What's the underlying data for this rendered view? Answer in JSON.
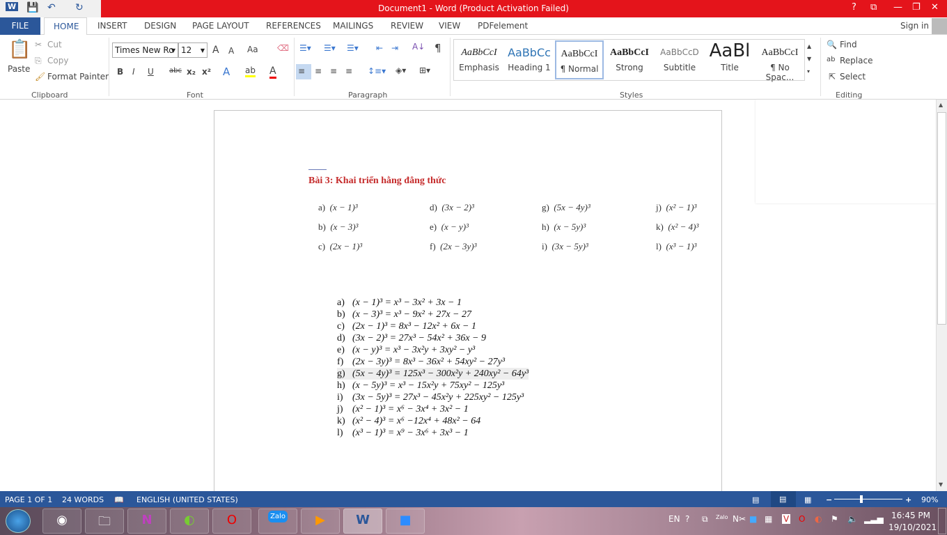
{
  "window": {
    "title": "Document1 - Word (Product Activation Failed)",
    "help": "?",
    "controls": [
      "ribbon-display",
      "minimize",
      "restore",
      "close"
    ]
  },
  "ribbon_tabs": [
    "FILE",
    "HOME",
    "INSERT",
    "DESIGN",
    "PAGE LAYOUT",
    "REFERENCES",
    "MAILINGS",
    "REVIEW",
    "VIEW",
    "PDFelement"
  ],
  "sign_in": "Sign in",
  "clipboard": {
    "paste": "Paste",
    "cut": "Cut",
    "copy": "Copy",
    "format_painter": "Format Painter",
    "group": "Clipboard"
  },
  "font": {
    "name": "Times New Ro",
    "size": "12",
    "group": "Font",
    "bold": "B",
    "italic": "I",
    "underline": "U",
    "strike": "abc",
    "sub": "x₂",
    "sup": "x²",
    "case": "Aa",
    "grow": "A",
    "shrink": "A"
  },
  "paragraph": {
    "group": "Paragraph",
    "pilcrow": "¶"
  },
  "styles": {
    "group": "Styles",
    "items": [
      {
        "preview": "AaBbCcI",
        "label": "Emphasis"
      },
      {
        "preview": "AaBbCc",
        "label": "Heading 1"
      },
      {
        "preview": "AaBbCcI",
        "label": "¶ Normal"
      },
      {
        "preview": "AaBbCcI",
        "label": "Strong"
      },
      {
        "preview": "AaBbCcD",
        "label": "Subtitle"
      },
      {
        "preview": "AaBl",
        "label": "Title"
      },
      {
        "preview": "AaBbCcI",
        "label": "¶ No Spac..."
      }
    ]
  },
  "editing": {
    "find": "Find",
    "replace": "Replace",
    "select": "Select",
    "group": "Editing"
  },
  "document": {
    "heading": "Bài 3: Khai triển hằng đẳng thức",
    "exercises": [
      [
        "a)",
        "(x − 1)³"
      ],
      [
        "b)",
        "(x − 3)³"
      ],
      [
        "c)",
        "(2x − 1)³"
      ],
      [
        "d)",
        "(3x − 2)³"
      ],
      [
        "e)",
        "(x − y)³"
      ],
      [
        "f)",
        "(2x − 3y)³"
      ],
      [
        "g)",
        "(5x − 4y)³"
      ],
      [
        "h)",
        "(x − 5y)³"
      ],
      [
        "i)",
        "(3x − 5y)³"
      ],
      [
        "j)",
        "(x² − 1)³"
      ],
      [
        "k)",
        "(x² − 4)³"
      ],
      [
        "l)",
        "(x³ − 1)³"
      ]
    ],
    "answers": [
      [
        "a)",
        "(x − 1)³ = x³ − 3x² + 3x − 1"
      ],
      [
        "b)",
        "(x − 3)³ = x³ − 9x² + 27x − 27"
      ],
      [
        "c)",
        "(2x − 1)³ = 8x³ − 12x² + 6x − 1"
      ],
      [
        "d)",
        "(3x − 2)³ = 27x³ − 54x² + 36x − 9"
      ],
      [
        "e)",
        "(x − y)³ = x³ − 3x²y + 3xy² − y³"
      ],
      [
        "f)",
        "(2x − 3y)³ = 8x³ − 36x² + 54xy² − 27y³"
      ],
      [
        "g)",
        "(5x − 4y)³ = 125x³ − 300x²y + 240xy² − 64y³"
      ],
      [
        "h)",
        "(x − 5y)³ = x³ − 15x²y + 75xy² − 125y³"
      ],
      [
        "i)",
        "(3x − 5y)³ = 27x³ − 45x²y + 225xy² − 125y³"
      ],
      [
        "j)",
        "(x² − 1)³ = x⁶ − 3x⁴ + 3x² − 1"
      ],
      [
        "k)",
        "(x² − 4)³ = x⁶ −12x⁴ + 48x² − 64"
      ],
      [
        "l)",
        "(x³ − 1)³ = x⁹ − 3x⁶ + 3x³ − 1"
      ]
    ]
  },
  "status": {
    "page": "PAGE 1 OF 1",
    "words": "24 WORDS",
    "language": "ENGLISH (UNITED STATES)",
    "zoom": "90%",
    "zoom_percent": 90
  },
  "taskbar": {
    "apps": [
      "Start",
      "Chrome",
      "File Explorer",
      "OneNote",
      "CCleaner",
      "Opera",
      "Zalo",
      "Media Player",
      "Word",
      "Zoom"
    ],
    "lang": "EN",
    "time": "16:45 PM",
    "date": "19/10/2021"
  },
  "colors": {
    "title_bar": "#e4141b",
    "accent": "#2b579a",
    "heading": "#c52b2b"
  }
}
